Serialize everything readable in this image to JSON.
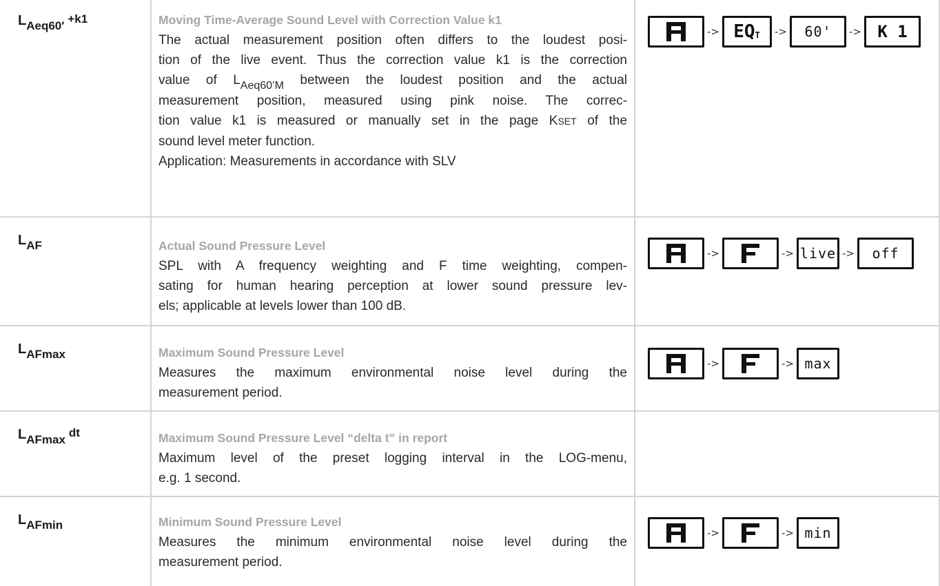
{
  "rows": [
    {
      "param": {
        "base": "L",
        "sub": "Aeq60′",
        "sup": "+k1"
      },
      "title": "Moving Time-Average Sound Level with Correction Value k1",
      "lines": [
        "The actual measurement position often differs to the loudest posi-",
        "tion of the live event. Thus the correction value k1 is the correction",
        [
          "value of L",
          "Aeq60’M",
          " between the loudest position and the actual"
        ],
        "measurement position, measured using pink noise. The correc-",
        [
          "tion value k1 is measured or manually set in the page K",
          "SET",
          " of the"
        ],
        "sound level meter function.",
        "Application: Measurements in accordance with SLV"
      ],
      "keys": [
        "A",
        "EQ",
        "60'",
        "K 1"
      ]
    },
    {
      "param": {
        "base": "L",
        "sub": "AF",
        "sup": ""
      },
      "title": "Actual Sound Pressure Level",
      "lines": [
        "SPL with A frequency weighting and F time weighting, compen-",
        "sating for human hearing perception at lower sound pressure lev-",
        "els; applicable at levels lower than 100 dB."
      ],
      "keys": [
        "A",
        "F",
        "live",
        "off"
      ]
    },
    {
      "param": {
        "base": "L",
        "sub": "AFmax",
        "sup": ""
      },
      "title": "Maximum Sound Pressure Level",
      "lines": [
        "Measures the maximum environmental noise level during the",
        "measurement period."
      ],
      "keys": [
        "A",
        "F",
        "max"
      ]
    },
    {
      "param": {
        "base": "L",
        "sub": "AFmax",
        "sup": "dt"
      },
      "title": "Maximum Sound Pressure Level “delta t” in report",
      "lines": [
        "Maximum level of the preset logging interval in the LOG-menu,",
        "e.g. 1 second."
      ],
      "keys": []
    },
    {
      "param": {
        "base": "L",
        "sub": "AFmin",
        "sup": ""
      },
      "title": "Minimum Sound Pressure Level",
      "lines": [
        "Measures the minimum environmental noise level during the",
        "measurement period."
      ],
      "keys": [
        "A",
        "F",
        "min"
      ]
    }
  ],
  "arrow_text": "->",
  "eq_subscript": "T"
}
